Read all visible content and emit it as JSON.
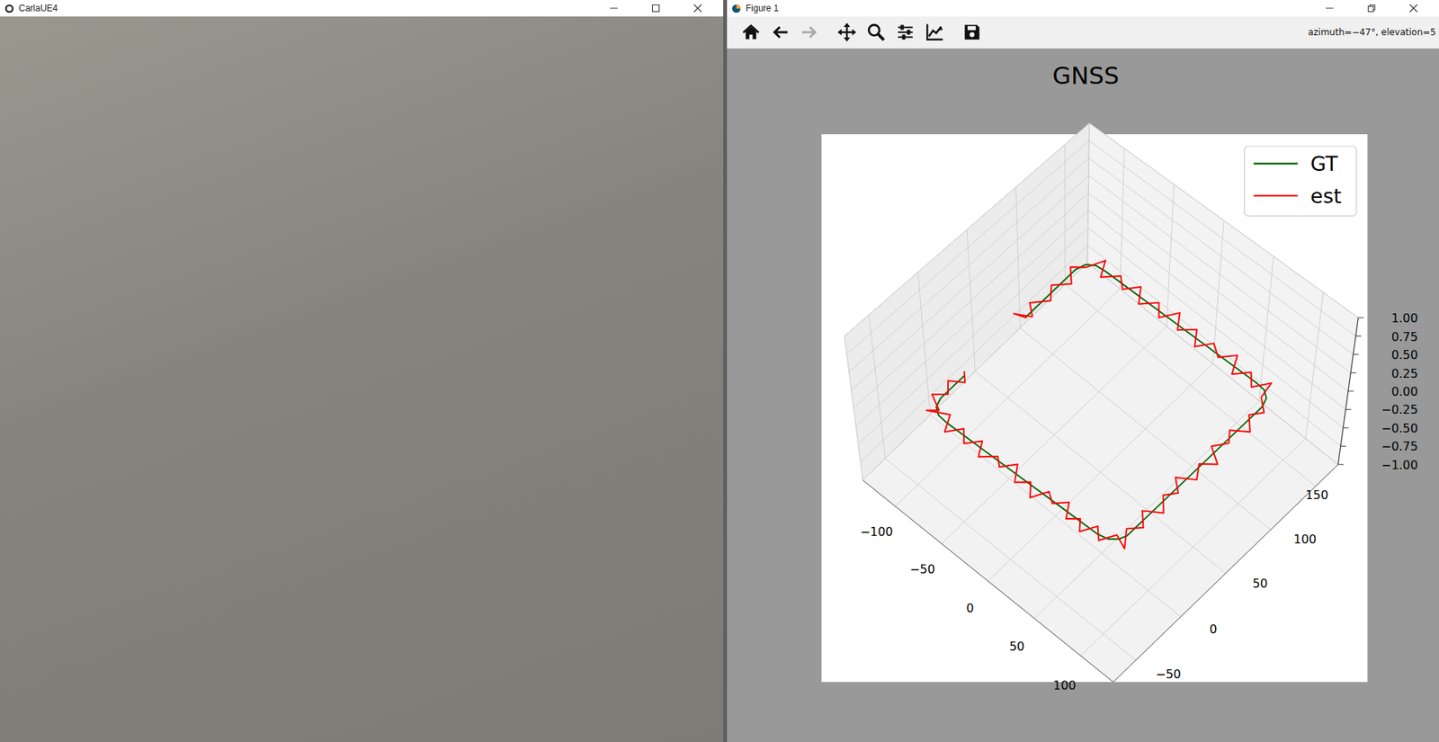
{
  "carla_window": {
    "title": "CarlaUE4"
  },
  "figure_window": {
    "title": "Figure 1",
    "toolbar": {
      "buttons": [
        {
          "kind": "home",
          "disabled": false
        },
        {
          "kind": "back",
          "disabled": false
        },
        {
          "kind": "forward",
          "disabled": true
        },
        {
          "kind": "move",
          "disabled": false
        },
        {
          "kind": "zoom",
          "disabled": false
        },
        {
          "kind": "configure",
          "disabled": false
        },
        {
          "kind": "edit",
          "disabled": false
        },
        {
          "kind": "save",
          "disabled": false
        }
      ],
      "coordinates": "azimuth=−47°, elevation=5"
    }
  },
  "chart": {
    "title": "GNSS",
    "x_ticks": [
      "−100",
      "−50",
      "0",
      "50",
      "100"
    ],
    "y_ticks": [
      "150",
      "100",
      "50",
      "0",
      "−50"
    ],
    "z_ticks": [
      "1.00",
      "0.75",
      "0.50",
      "0.25",
      "0.00",
      "−0.25",
      "−0.50",
      "−0.75",
      "−1.00"
    ],
    "series": [
      {
        "label": "GT",
        "color": "#006400",
        "points": [
          [
            -105,
            -15
          ],
          [
            -105,
            -30
          ],
          [
            -105,
            -45
          ],
          [
            -102,
            -54
          ],
          [
            -95,
            -59
          ],
          [
            -85,
            -60
          ],
          [
            -50,
            -60
          ],
          [
            0,
            -60
          ],
          [
            50,
            -60
          ],
          [
            85,
            -60
          ],
          [
            95,
            -58
          ],
          [
            102,
            -52
          ],
          [
            105,
            -45
          ],
          [
            105,
            0
          ],
          [
            105,
            50
          ],
          [
            105,
            100
          ],
          [
            105,
            125
          ],
          [
            102,
            134
          ],
          [
            95,
            139
          ],
          [
            85,
            140
          ],
          [
            40,
            140
          ],
          [
            0,
            140
          ],
          [
            -40,
            140
          ],
          [
            -85,
            140
          ],
          [
            -95,
            139
          ],
          [
            -102,
            134
          ],
          [
            -105,
            125
          ],
          [
            -105,
            100
          ],
          [
            -105,
            80
          ],
          [
            -105,
            62
          ]
        ]
      },
      {
        "label": "est",
        "color": "#ff0000",
        "points": [
          [
            -108,
            -12
          ],
          [
            -100,
            -20
          ],
          [
            -112,
            -28
          ],
          [
            -103,
            -38
          ],
          [
            -113,
            -47
          ],
          [
            -98,
            -55
          ],
          [
            -106,
            -62
          ],
          [
            -88,
            -52
          ],
          [
            -80,
            -68
          ],
          [
            -70,
            -55
          ],
          [
            -60,
            -66
          ],
          [
            -50,
            -54
          ],
          [
            -42,
            -68
          ],
          [
            -30,
            -57
          ],
          [
            -22,
            -64
          ],
          [
            -12,
            -52
          ],
          [
            -2,
            -67
          ],
          [
            8,
            -58
          ],
          [
            18,
            -70
          ],
          [
            26,
            -55
          ],
          [
            36,
            -62
          ],
          [
            46,
            -52
          ],
          [
            55,
            -66
          ],
          [
            64,
            -58
          ],
          [
            72,
            -68
          ],
          [
            80,
            -54
          ],
          [
            90,
            -64
          ],
          [
            98,
            -50
          ],
          [
            112,
            -56
          ],
          [
            100,
            -40
          ],
          [
            110,
            -30
          ],
          [
            98,
            -18
          ],
          [
            113,
            -8
          ],
          [
            101,
            5
          ],
          [
            109,
            15
          ],
          [
            97,
            25
          ],
          [
            112,
            35
          ],
          [
            103,
            48
          ],
          [
            115,
            58
          ],
          [
            99,
            68
          ],
          [
            108,
            80
          ],
          [
            100,
            90
          ],
          [
            114,
            100
          ],
          [
            102,
            112
          ],
          [
            110,
            122
          ],
          [
            98,
            132
          ],
          [
            95,
            148
          ],
          [
            85,
            134
          ],
          [
            75,
            145
          ],
          [
            64,
            133
          ],
          [
            55,
            150
          ],
          [
            44,
            138
          ],
          [
            32,
            146
          ],
          [
            22,
            133
          ],
          [
            12,
            147
          ],
          [
            0,
            136
          ],
          [
            -10,
            150
          ],
          [
            -20,
            135
          ],
          [
            -30,
            146
          ],
          [
            -42,
            134
          ],
          [
            -52,
            148
          ],
          [
            -62,
            136
          ],
          [
            -72,
            145
          ],
          [
            -84,
            133
          ],
          [
            -92,
            148
          ],
          [
            -100,
            132
          ],
          [
            -110,
            124
          ],
          [
            -98,
            112
          ],
          [
            -110,
            100
          ],
          [
            -100,
            88
          ],
          [
            -112,
            75
          ],
          [
            -101,
            66
          ],
          [
            -115,
            58
          ],
          [
            -104,
            62
          ]
        ]
      }
    ]
  }
}
